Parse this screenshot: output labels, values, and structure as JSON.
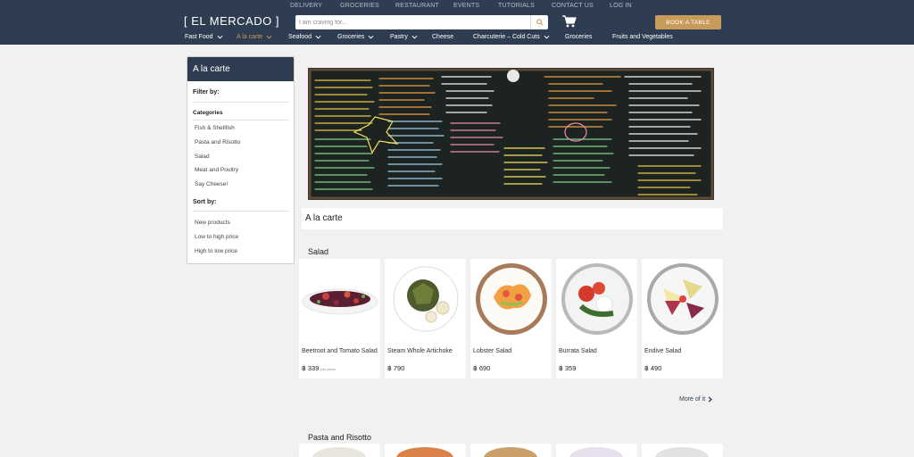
{
  "top_nav": [
    "DELIVERY",
    "GROCERIES",
    "RESTAURANT",
    "EVENTS",
    "TUTORIALS",
    "CONTACT US",
    "LOG IN"
  ],
  "logo": "[ EL MERCADO ]",
  "search": {
    "placeholder": "I am craving for..."
  },
  "book_button": "BOOK A TABLE",
  "categories": [
    {
      "label": "Fast Food",
      "dropdown": true
    },
    {
      "label": "A la carte",
      "dropdown": true,
      "active": true
    },
    {
      "label": "Seafood",
      "dropdown": true
    },
    {
      "label": "Groceries",
      "dropdown": true
    },
    {
      "label": "Pastry",
      "dropdown": true
    },
    {
      "label": "Cheese",
      "dropdown": false
    },
    {
      "label": "Charcuterie – Cold Cuts",
      "dropdown": true
    },
    {
      "label": "Groceries",
      "dropdown": false
    },
    {
      "label": "Fruits and Vegetables",
      "dropdown": false
    }
  ],
  "sidebar": {
    "title": "A la carte",
    "filter_label": "Filter by:",
    "categories_label": "Categories",
    "categories": [
      "Fish & Shellfish",
      "Pasta and Risotto",
      "Salad",
      "Meat and Poultry",
      "Say Cheese!"
    ],
    "sort_label": "Sort by:",
    "sort_options": [
      "New products",
      "Low to high price",
      "High to low price"
    ]
  },
  "page_title": "A la carte",
  "sections": [
    {
      "title": "Salad",
      "products": [
        {
          "name": "Beetroot and Tomato Salad",
          "price": "฿ 339",
          "unit": "per piece"
        },
        {
          "name": "Steam Whole Artichoke",
          "price": "฿ 790"
        },
        {
          "name": "Lobster Salad",
          "price": "฿ 690"
        },
        {
          "name": "Burrata Salad",
          "price": "฿ 359"
        },
        {
          "name": "Endive Salad",
          "price": "฿ 490"
        }
      ],
      "more": "More of it"
    },
    {
      "title": "Pasta and Risotto"
    }
  ],
  "colors": {
    "header_bg": "#2e3d51",
    "accent": "#c99b5a",
    "page_bg": "#f1f1f1"
  }
}
